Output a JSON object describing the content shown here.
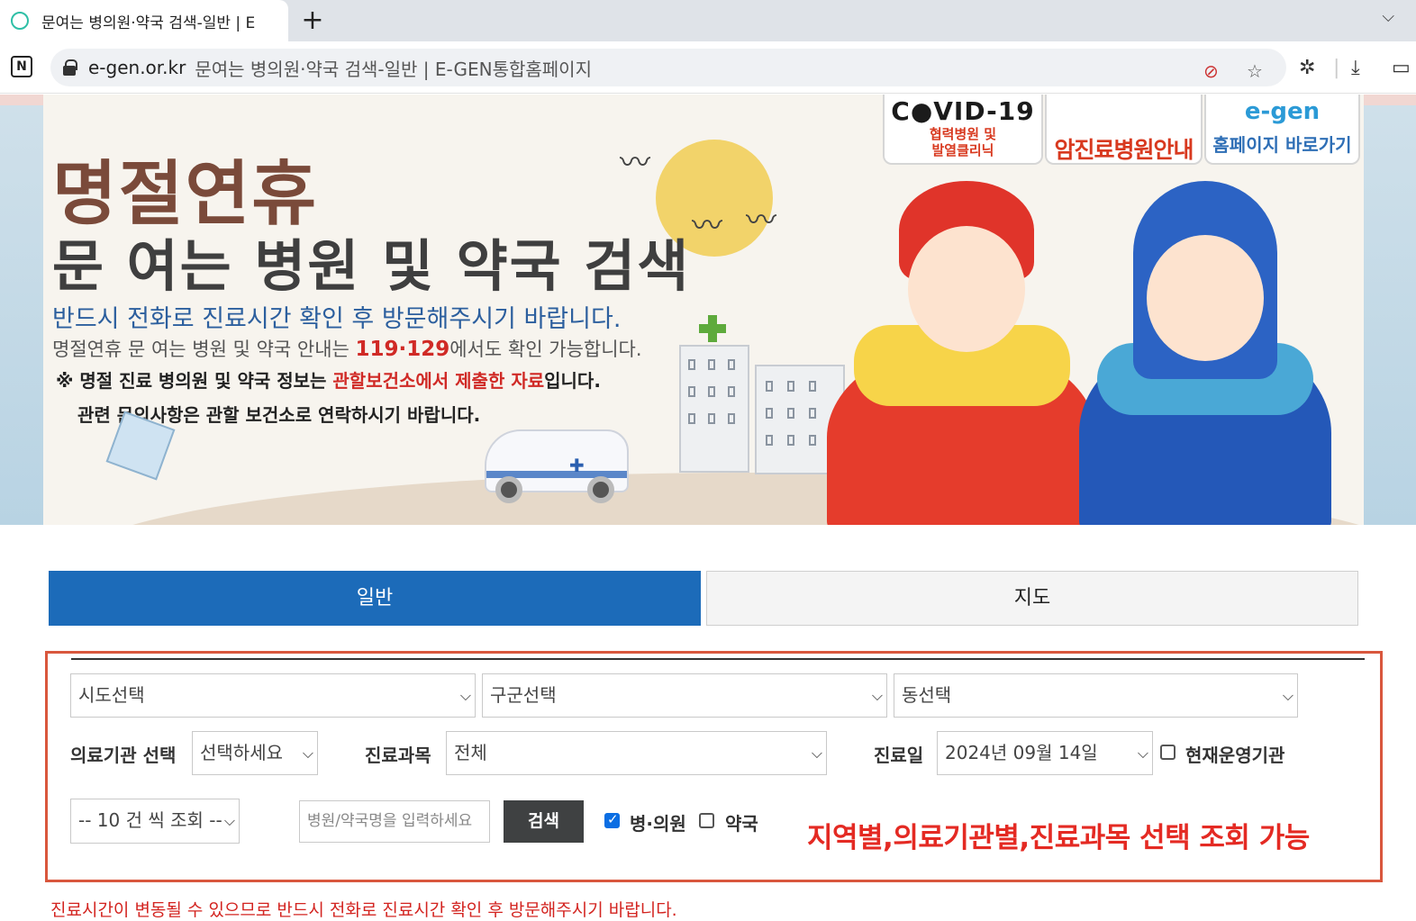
{
  "browser": {
    "tab_title": "문여는 병의원·약국 검색-일반 | E",
    "url_domain": "e-gen.or.kr",
    "url_title": "문여는 병의원·약국 검색-일반 | E-GEN통합홈페이지",
    "new_tab_label": "+"
  },
  "banner": {
    "title_main": "명절연휴",
    "title_sub": "문 여는 병원 및 약국 검색",
    "line1": "반드시 전화로 진료시간 확인 후 방문해주시기 바랍니다.",
    "line2_pre": "명절연휴 문 여는 병원 및 약국 안내는 ",
    "line2_hl": "119·129",
    "line2_post": "에서도 확인 가능합니다.",
    "line3_pre": "※ 명절 진료 병의원 및 약국 정보는 ",
    "line3_hl": "관할보건소에서 제출한 자료",
    "line3_post": "입니다.",
    "line4": "관련 문의사항은 관할 보건소로 연락하시기 바랍니다."
  },
  "quick_links": {
    "covid_title": "C●VID-19",
    "covid_sub1": "협력병원 및",
    "covid_sub2": "발열클리닉",
    "cancer": "암진료병원안내",
    "home_logo": "e-gen",
    "home": "홈페이지 바로가기"
  },
  "tabs": [
    {
      "label": "일반",
      "active": true
    },
    {
      "label": "지도",
      "active": false
    }
  ],
  "search": {
    "sido": "시도선택",
    "gugun": "구군선택",
    "dong": "동선택",
    "org_label": "의료기관 선택",
    "org_value": "선택하세요",
    "dept_label": "진료과목",
    "dept_value": "전체",
    "date_label": "진료일",
    "date_value": "2024년 09월 14일",
    "operating_label": "현재운영기관",
    "operating_checked": false,
    "page_size": "-- 10 건 씩 조회 --",
    "name_placeholder": "병원/약국명을 입력하세요",
    "search_button": "검색",
    "hospital_label": "병·의원",
    "hospital_checked": true,
    "pharmacy_label": "약국",
    "pharmacy_checked": false
  },
  "annotation": "지역별,의료기관별,진료과목 선택 조회 가능",
  "notice": "진료시간이 변동될 수 있으므로 반드시 전화로 진료시간 확인 후 방문해주시기 바랍니다.",
  "colors": {
    "tab_active": "#1c6bb9",
    "highlight_red": "#e42a23",
    "frame": "#d9573d"
  }
}
